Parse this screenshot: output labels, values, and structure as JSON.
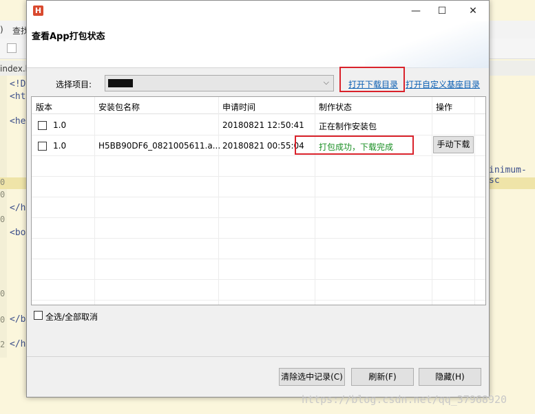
{
  "editor": {
    "menu_items": [
      ")",
      "查找"
    ],
    "tab_name": "index.ht",
    "lines": [
      "<!D",
      "<ht",
      "<he",
      "</h",
      "<bo",
      "</b",
      "</h"
    ],
    "line_numbers": [
      "0",
      "0",
      "0",
      "0",
      "0",
      "2"
    ],
    "right_text": "inimum-sc"
  },
  "dialog": {
    "title": "查看App打包状态",
    "window_controls": {
      "minimize": "—",
      "maximize": "☐",
      "close": "✕"
    },
    "project_label": "选择项目:",
    "open_download_dir": "打开下载目录",
    "open_custom_base_dir": "打开自定义基座目录",
    "table": {
      "headers": [
        "版本",
        "安装包名称",
        "申请时间",
        "制作状态",
        "操作"
      ],
      "rows": [
        {
          "version": "1.0",
          "package_name": "",
          "request_time": "20180821 12:50:41",
          "status": "正在制作安装包",
          "action": ""
        },
        {
          "version": "1.0",
          "package_name": "H5BB90DF6_0821005611.a...",
          "request_time": "20180821 00:55:04",
          "status": "打包成功，下载完成",
          "action": "手动下载"
        }
      ]
    },
    "select_all_label": "全选/全部取消",
    "buttons": {
      "clear": "清除选中记录(C)",
      "refresh": "刷新(F)",
      "hide": "隐藏(H)"
    }
  },
  "watermark": "https://blog.csdn.net/qq_37968920",
  "colors": {
    "accent_red": "#d9212a",
    "link_blue": "#0b5fb3",
    "success_green": "#1a8f24"
  }
}
